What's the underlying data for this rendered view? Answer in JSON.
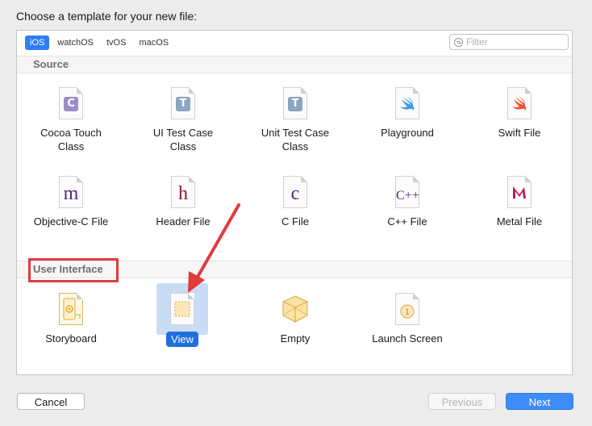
{
  "dialog": {
    "prompt": "Choose a template for your new file:"
  },
  "platform_tabs": [
    "iOS",
    "watchOS",
    "tvOS",
    "macOS"
  ],
  "filter": {
    "placeholder": "Filter"
  },
  "sections": {
    "source": {
      "title": "Source",
      "items": [
        {
          "label": "Cocoa Touch\nClass",
          "glyph": "C",
          "color": "#9b8ec6"
        },
        {
          "label": "UI Test Case\nClass",
          "glyph": "T",
          "color": "#8aa4c2"
        },
        {
          "label": "Unit Test Case\nClass",
          "glyph": "T",
          "color": "#8aa4c2"
        },
        {
          "label": "Playground",
          "glyph": "swift-bird-icon",
          "color": "#3d9ae8"
        },
        {
          "label": "Swift File",
          "glyph": "swift-bird-icon",
          "color": "#f05138"
        },
        {
          "label": "Objective-C File",
          "glyph": "m",
          "color": "#4b2a7a"
        },
        {
          "label": "Header File",
          "glyph": "h",
          "color": "#8b1a2a"
        },
        {
          "label": "C File",
          "glyph": "c",
          "color": "#4b2a7a"
        },
        {
          "label": "C++ File",
          "glyph": "C++",
          "color": "#4b2a7a"
        },
        {
          "label": "Metal File",
          "glyph": "metal-icon",
          "color": "#c2185b"
        }
      ]
    },
    "user_interface": {
      "title": "User Interface",
      "items": [
        {
          "label": "Storyboard",
          "icon": "storyboard-icon"
        },
        {
          "label": "View",
          "icon": "view-icon",
          "selected": true
        },
        {
          "label": "Empty",
          "icon": "empty-cube-icon"
        },
        {
          "label": "Launch Screen",
          "icon": "launch-screen-icon"
        }
      ]
    }
  },
  "buttons": {
    "cancel": "Cancel",
    "previous": "Previous",
    "next": "Next"
  },
  "annotations": {
    "highlight_color": "#e23b3b"
  }
}
